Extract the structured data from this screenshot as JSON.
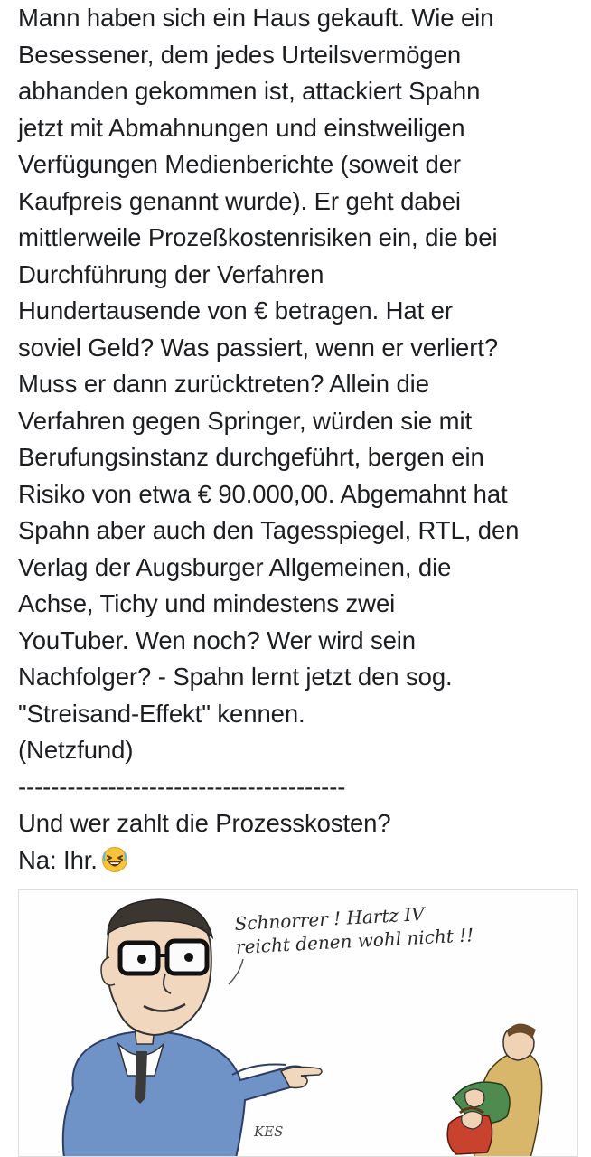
{
  "post": {
    "lines": [
      "Mann haben sich ein Haus gekauft. Wie ein",
      "Besessener, dem jedes Urteilsvermögen",
      "abhanden gekommen ist, attackiert Spahn",
      "jetzt mit Abmahnungen und einstweiligen",
      "Verfügungen Medienberichte (soweit der",
      "Kaufpreis genannt wurde). Er geht dabei",
      "mittlerweile Prozeßkostenrisiken ein, die bei",
      "Durchführung der Verfahren",
      "Hundertausende von € betragen. Hat er",
      "soviel Geld? Was passiert, wenn er verliert?",
      "Muss er dann zurücktreten? Allein die",
      "Verfahren gegen Springer, würden sie mit",
      "Berufungsinstanz durchgeführt, bergen ein",
      "Risiko von etwa € 90.000,00. Abgemahnt hat",
      "Spahn aber auch den Tagesspiegel, RTL, den",
      "Verlag der Augsburger Allgemeinen, die",
      "Achse, Tichy und mindestens zwei",
      "YouTuber. Wen noch? Wer wird sein",
      "Nachfolger? - Spahn lernt jetzt den sog.",
      "\"Streisand-Effekt\" kennen.",
      "(Netzfund)",
      "----------------------------------------",
      "Und wer zahlt die Prozesskosten?",
      "Na: Ihr."
    ],
    "emoji": "laughing-face-icon"
  },
  "attachment": {
    "caption_line1": "Schnorrer ! Hartz IV",
    "caption_line2": "reicht denen wohl nicht !!",
    "signature": "KES"
  },
  "colors": {
    "text": "#1c1e21",
    "emoji_face": "#f7c338",
    "suit": "#6f93c7"
  }
}
